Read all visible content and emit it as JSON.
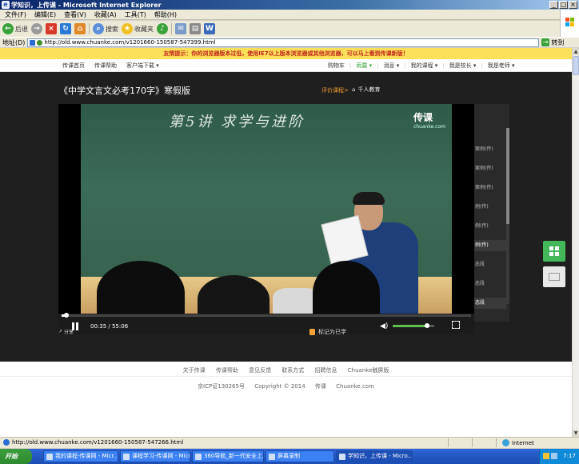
{
  "window": {
    "title": "学知识，上传课 - Microsoft Internet Explorer"
  },
  "menubar": {
    "items": [
      "文件(F)",
      "编辑(E)",
      "查看(V)",
      "收藏(A)",
      "工具(T)",
      "帮助(H)"
    ]
  },
  "toolbar": {
    "back_label": "后退",
    "search_label": "搜索",
    "favorites_label": "收藏夹"
  },
  "address": {
    "label": "地址(D)",
    "url": "http://old.www.chuanke.com/v1201660-150587-547399.html",
    "go_label": "转到"
  },
  "notice": {
    "text": "友情提示：你的浏览器版本过低，使用IE7以上版本浏览器或其他浏览器，可以马上看到传课新版！"
  },
  "topnav": {
    "left": [
      "传课首页",
      "传课帮助",
      "客户端下载 ▾"
    ],
    "right": [
      "购物车",
      "|",
      "雨露 ▾",
      "|",
      "消息 ▾",
      "|",
      "我的课程 ▾",
      "|",
      "我是校长 ▾",
      "|",
      "我是老师 ▾"
    ]
  },
  "course": {
    "title": "《中学文言文必考170字》寒假版",
    "rating_label": "评价课程>",
    "org_label": "千人教育"
  },
  "video": {
    "chalk_text": "第5讲  求学与进阶",
    "watermark": "传课",
    "watermark_sub": "chuanke.com",
    "time": "00:35 / 55:06",
    "progress": 0.011,
    "volume": 0.82,
    "share_label": "分享",
    "note_label": "标记为已学"
  },
  "lessons": [
    {
      "label": "案例(传)",
      "active": false
    },
    {
      "label": "案例(传)",
      "active": false
    },
    {
      "label": "案例(传)",
      "active": false
    },
    {
      "label": "例(传)",
      "active": false
    },
    {
      "label": "例(传)",
      "active": false
    },
    {
      "label": "例(传)",
      "active": true
    },
    {
      "label": "态段",
      "active": false
    },
    {
      "label": "态段",
      "active": false
    },
    {
      "label": "态段",
      "active": true
    }
  ],
  "footer": {
    "links": [
      "关于传课",
      "传课帮助",
      "意见反馈",
      "联系方式",
      "招聘信息",
      "Chuanke触屏版"
    ],
    "copyright": [
      "京ICP证130265号",
      "Copyright © 2014",
      "传课",
      "Chuanke.com"
    ]
  },
  "statusbar": {
    "url": "http://old.www.chuanke.com/v1201660-150587-547266.html",
    "zone": "Internet"
  },
  "taskbar": {
    "start_label": "开始",
    "tasks": [
      {
        "label": "我的课程-传课网 - Micr...",
        "active": false
      },
      {
        "label": "课程学习-传课网 - Micr...",
        "active": false
      },
      {
        "label": "360导航_新一代安全上...",
        "active": false
      },
      {
        "label": "屏幕录制",
        "active": false
      },
      {
        "label": "学知识，上传课 - Micro...",
        "active": true
      }
    ],
    "clock": "7:17"
  }
}
